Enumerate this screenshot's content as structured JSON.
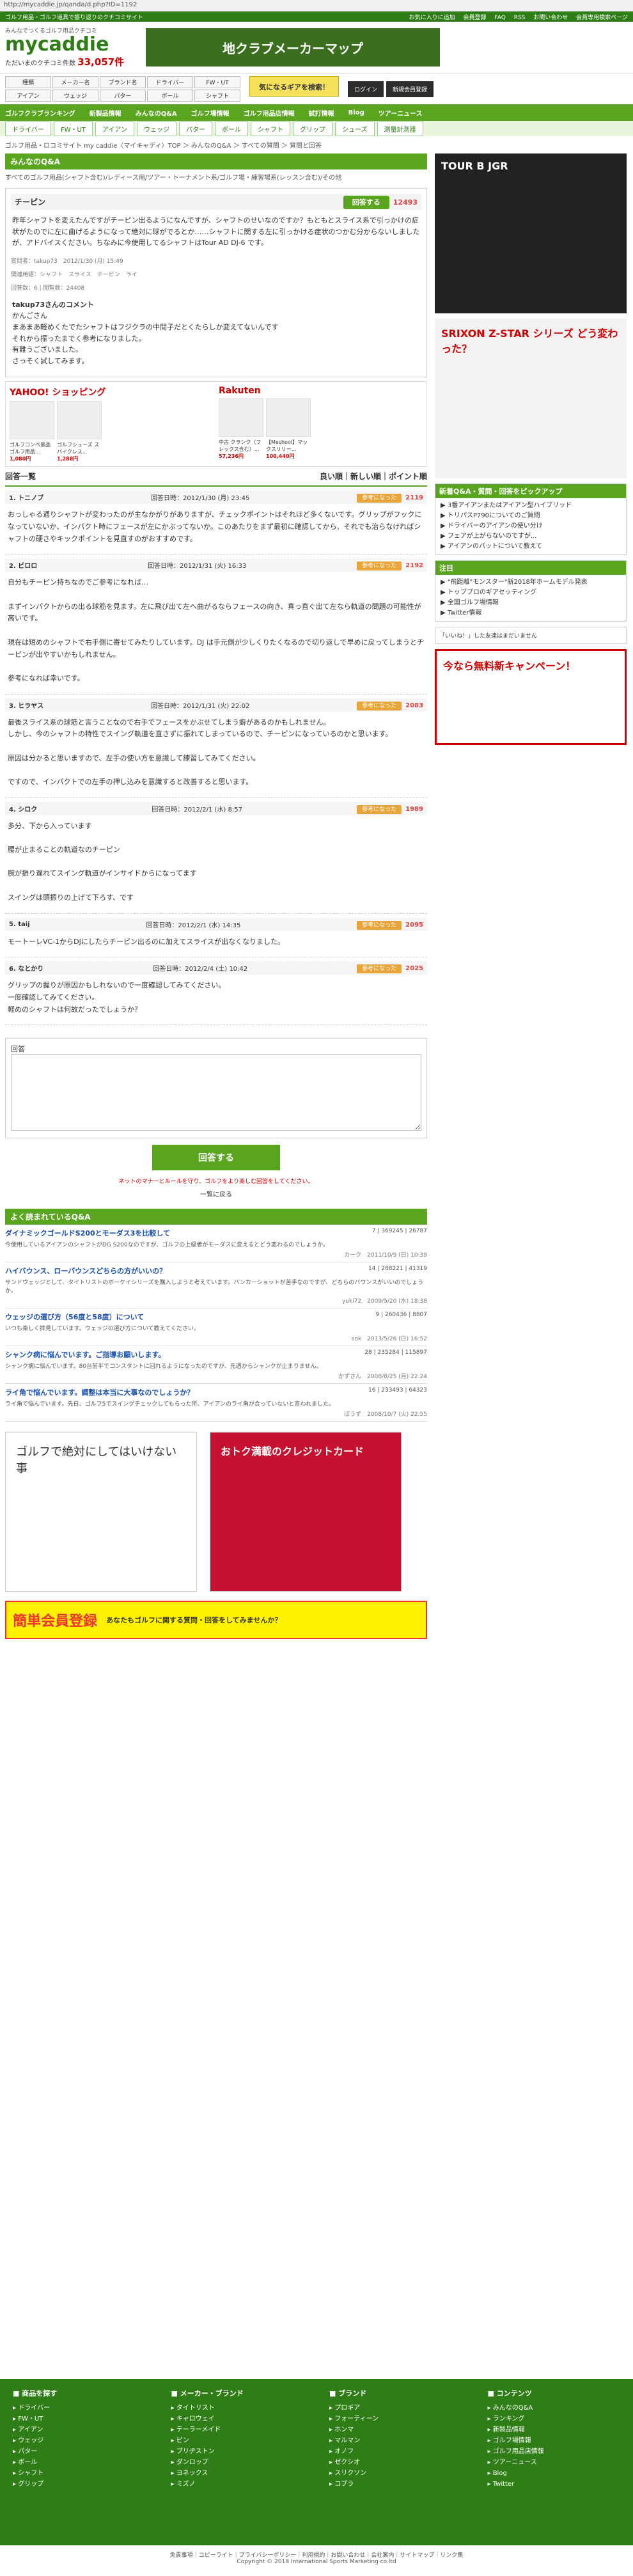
{
  "url": "http://mycaddie.jp/qanda/d.php?ID=1192",
  "top": {
    "tagline": "ゴルフ用品・ゴルフ道具で振り返りのクチコミサイト",
    "links": [
      "お気に入りに追加",
      "会員登録",
      "FAQ",
      "RSS",
      "お問い合わせ",
      "会員専用検索ページ"
    ]
  },
  "header": {
    "logo_sub": "みんなでつくるゴルフ用品クチコミ",
    "brand": "mycaddie",
    "count_label": "ただいまのクチコミ件数",
    "count": "33,057件",
    "banner": "地クラブメーカーマップ"
  },
  "search": {
    "fields": [
      "種類",
      "メーカー名",
      "ブランド名",
      "ドライバー",
      "FW・UT",
      "アイアン",
      "ウェッジ",
      "パター",
      "ボール",
      "シャフト",
      "グリップ",
      "シューズ",
      "ウェア"
    ],
    "button": "気になるギアを検索！",
    "login": "ログイン",
    "register": "新規会員登録"
  },
  "gnav": [
    "ゴルフクラブランキング",
    "新製品情報",
    "みんなのQ&A",
    "ゴルフ場情報",
    "ゴルフ用品店情報",
    "試打情報",
    "Blog",
    "ツアーニュース"
  ],
  "catnav": [
    "ドライバー",
    "FW・UT",
    "アイアン",
    "ウェッジ",
    "パター",
    "ボール",
    "シャフト",
    "グリップ",
    "シューズ",
    "測量計測器"
  ],
  "crumb": "ゴルフ用品・ロコミサイト my caddie（マイキャディ）TOP ＞ みんなのQ&A ＞ すべての質問 ＞ 質問と回答",
  "section": "みんなのQ&A",
  "category_label": "すべてのゴルフ用品(シャフト含む)/レディース用/ツアー・トーナメント系/ゴルフ場・練習場系(レッスン含む)/その他",
  "q": {
    "title": "チーピン",
    "answer_btn": "回答する",
    "points": "12493",
    "body": "昨年シャフトを変えたんですがチーピン出るようになんですが、シャフトのせいなのですか？もともとスライス系で引っかけの症状がたのでに左に曲げるようになって絶対に球がでるとか……シャフトに関する左に引っかける症状のつかむ分からないしましたが、アドバイスください。ちなみに今使用してるシャフトはTour AD DJ-6 です。",
    "poster_label": "質問者",
    "poster": "takup73",
    "date": "2012/1/30 (月) 15:49",
    "tags": "関連用語：シャフト　スライス　チーピン　ライ",
    "views": "回答数：6 | 閲覧数：24408",
    "followup_user": "takup73さんのコメント",
    "followup": "かんごさん\nまあまあ軽めくたでたシャフトはフジクラの中間子だとくたらしか変えてないんです\nそれから振ったまでく参考になりました。\n有難うございました。\nさっそく試してみます。"
  },
  "shop": {
    "yahoo": "YAHOO! ショッピング",
    "rakuten": "Rakuten",
    "items": [
      {
        "name": "ゴルフコンペ景品 ゴルフ用品...",
        "price": "1,080円"
      },
      {
        "name": "ゴルフシューズ スパイクレス...",
        "price": "1,288円"
      },
      {
        "name": "中古 クランク（フレックス含む）...",
        "price": "57,236円"
      },
      {
        "name": "【Meshool】マックスリリー...",
        "price": "100,440円"
      }
    ]
  },
  "ansbar": {
    "left": "回答一覧",
    "right": "良い順｜新しい順｜ポイント順"
  },
  "answers": [
    {
      "num": "1. トニノブ",
      "date": "回答日時：2012/1/30 (月) 23:45",
      "pts": "2119",
      "body": "おっしゃる通りシャフトが変わったのが主なかがりがありますが、チェックポイントはそれほど多くないです。グリップがフックになっていないか、インパクト時にフェースが左にかぶってないか。このあたりをまず最初に確認してから、それでも治らなければシャフトの硬さやキックポイントを見直すのがおすすめです。"
    },
    {
      "num": "2. ビロロ",
      "date": "回答日時：2012/1/31 (火) 16:33",
      "pts": "2192",
      "body": "自分もチーピン持ちなのでご参考になれば…\n\nまずインパクトからの出る球筋を見ます。左に飛び出て左へ曲がるならフェースの向き、真っ直ぐ出て左なら軌道の問題の可能性が高いです。\n\n現在は短めのシャフトで右手側に寄せてみたりしています。DJ は手元側が少しくりたくなるので切り返しで早めに戻ってしまうとチーピンが出やすいかもしれません。\n\n参考になれば幸いです。"
    },
    {
      "num": "3. ヒラヤス",
      "date": "回答日時：2012/1/31 (火) 22:02",
      "pts": "2083",
      "body": "最後スライス系の球筋と言うことなので右手でフェースをかぶせてしまう癖があるのかもしれません。\nしかし、今のシャフトの特性でスイング軌道を直さずに振れてしまっているので、チーピンになっているのかと思います。\n\n原因は分かると思いますので、左手の使い方を意識して練習してみてください。\n\nですので、インパクトでの左手の押し込みを意識すると改善すると思います。"
    },
    {
      "num": "4. シロク",
      "date": "回答日時：2012/2/1 (水) 8:57",
      "pts": "1989",
      "body": "多分、下から入っています\n\n腰が止まることの軌道なのチーピン\n\n腕が振り遅れてスイング軌道がインサイドからになってます\n\nスイングは頭振りの上げて下ろす、です"
    },
    {
      "num": "5. taij",
      "date": "回答日時：2012/2/1 (水) 14:35",
      "pts": "2095",
      "body": "モートーレVC-1からDJにしたらチーピン出るのに加えてスライスが出なくなりました。"
    },
    {
      "num": "6. なとかり",
      "date": "回答日時：2012/2/4 (土) 10:42",
      "pts": "2025",
      "body": "グリップの握りが原因かもしれないので一度確認してみてください。\n一度確認してみてください。\n軽めのシャフトは何故だったでしょうか？"
    }
  ],
  "form": {
    "label": "回答",
    "submit": "回答する",
    "notice": "ネットのマナーとルールを守り、ゴルフをより楽しむ回答をしてください。",
    "back": "一覧に戻る"
  },
  "related": {
    "title": "よく読まれているQ&A",
    "items": [
      {
        "t": "ダイナミックゴールドS200とモーダス3を比較して",
        "stats": "7 | 369245 | 26787",
        "body": "今使用しているアイアンのシャフトがDG S200なのですが、ゴルフの上級者がモーダスに変えるとどう変わるのでしょうか。",
        "user": "カーク",
        "date": "2011/10/9 (日) 10:39"
      },
      {
        "t": "ハイバウンス、ローバウンスどちらの方がいいの？",
        "stats": "14 | 288221 | 41319",
        "body": "サンドウェッジとして、タイトリストのボーケイシリーズを購入しようと考えています。バンカーショットが苦手なのですが、どちらのバウンスがいいのでしょうか。",
        "user": "yuki72",
        "date": "2009/5/20 (水) 18:38"
      },
      {
        "t": "ウェッジの選び方（56度と58度）について",
        "stats": "9 | 260436 | 8807",
        "body": "いつも楽しく拝見しています。ウェッジの選び方について教えてください。",
        "user": "sok",
        "date": "2013/5/26 (日) 16:52"
      },
      {
        "t": "シャンク病に悩んでいます。ご指導お願いします。",
        "stats": "28 | 235284 | 115897",
        "body": "シャンク病に悩んでいます。80台前半でコンスタントに回れるようになったのですが、先週からシャンクが止まりません。",
        "user": "かずさん",
        "date": "2008/8/25 (月) 22:24"
      },
      {
        "t": "ライ角で悩んでいます。調整は本当に大事なのでしょうか？",
        "stats": "16 | 233493 | 64323",
        "body": "ライ角で悩んでいます。先日、ゴルフ5でスイングチェックしてもらった所、アイアンのライ角が合っていないと言われました。",
        "user": "ぼうず",
        "date": "2008/10/7 (火) 22:55"
      }
    ]
  },
  "ads": {
    "ad1": "ゴルフで絶対にしてはいけない事",
    "ad2": "おトク満載のクレジットカード",
    "reg": "簡単会員登録",
    "reg_sub": "あなたもゴルフに関する質問・回答をしてみませんか？"
  },
  "side": {
    "ad_top": "TOUR B JGR",
    "ad_srixon": "SRIXON Z-STAR シリーズ どう変わった？",
    "qa_title": "新着Q&A・質問・回答をピックアップ",
    "qa": [
      "3番アイアンまたはアイアン型ハイブリッド",
      "トリパスP790についてのご質問",
      "ドライバーのアイアンの使い分け",
      "フェアが上がらないのですが...",
      "アイアンのパットについて教えて"
    ],
    "news_title": "注目",
    "news": [
      "\"飛距離\"モンスター\"新2018年ホームモデル発表",
      "トッププロのギアセッティング",
      "全国ゴルフ場情報",
      "Twitter情報"
    ],
    "like": "「いいね！」した友達はまだいません",
    "promo": "今なら無料新キャンペーン！"
  },
  "footer": {
    "cols": [
      {
        "hd": "商品を探す",
        "items": [
          "ドライバー",
          "FW・UT",
          "アイアン",
          "ウェッジ",
          "パター",
          "ボール",
          "シャフト",
          "グリップ"
        ]
      },
      {
        "hd": "メーカー・ブランド",
        "items": [
          "タイトリスト",
          "キャロウェイ",
          "テーラーメイド",
          "ピン",
          "ブリヂストン",
          "ダンロップ",
          "ヨネックス",
          "ミズノ"
        ]
      },
      {
        "hd": "ブランド",
        "items": [
          "プロギア",
          "フォーティーン",
          "ホンマ",
          "マルマン",
          "オノフ",
          "ゼクシオ",
          "スリクソン",
          "コブラ"
        ]
      },
      {
        "hd": "コンテンツ",
        "items": [
          "みんなのQ&A",
          "ランキング",
          "新製品情報",
          "ゴルフ場情報",
          "ゴルフ用品店情報",
          "ツアーニュース",
          "Blog",
          "Twitter"
        ]
      }
    ],
    "links": "免責事項｜コピーライト｜プライバシーポリシー｜利用規約｜お問い合わせ｜会社案内｜サイトマップ｜リンク集",
    "copy": "Copyright © 2018 International Sports Marketing co.ltd"
  }
}
